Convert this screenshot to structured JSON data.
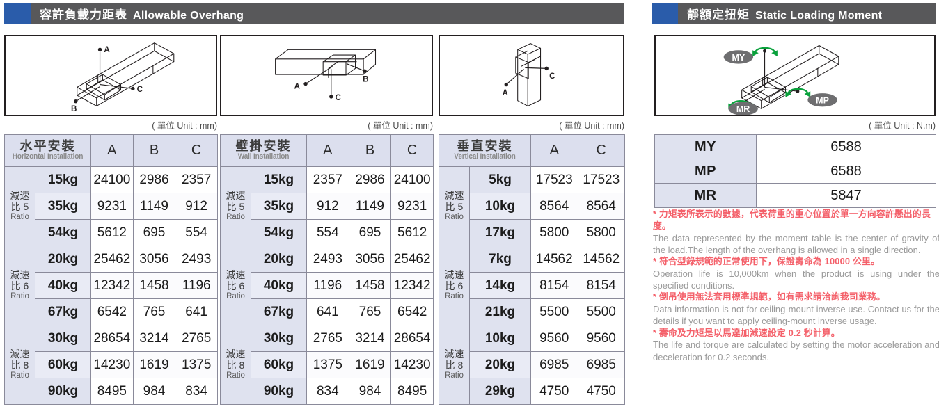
{
  "sections": {
    "overhang": {
      "title_cn": "容許負載力距表",
      "title_en": "Allowable Overhang",
      "accent_color": "#2a5caa",
      "bar_color": "#58585a"
    },
    "moment": {
      "title_cn": "靜額定扭矩",
      "title_en": "Static Loading Moment",
      "accent_color": "#2a5caa",
      "bar_color": "#58585a"
    }
  },
  "unit_labels": {
    "mm": "( 單位 Unit : mm)",
    "nm": "( 單位 Unit : N.m)"
  },
  "diagram_markers": {
    "horizontal": [
      "A",
      "B",
      "C"
    ],
    "wall": [
      "A",
      "B",
      "C"
    ],
    "vertical": [
      "A",
      "C"
    ],
    "moment": [
      "MY",
      "MP",
      "MR"
    ]
  },
  "overhang_tables": [
    {
      "id": "horizontal",
      "header_cn": "水平安裝",
      "header_en": "Horizontal Installation",
      "columns": [
        "A",
        "B",
        "C"
      ],
      "groups": [
        {
          "ratio_line1": "減速",
          "ratio_line2": "比 5",
          "ratio_line3": "Ratio",
          "rows": [
            {
              "load": "15kg",
              "values": [
                "24100",
                "2986",
                "2357"
              ]
            },
            {
              "load": "35kg",
              "values": [
                "9231",
                "1149",
                "912"
              ]
            },
            {
              "load": "54kg",
              "values": [
                "5612",
                "695",
                "554"
              ]
            }
          ]
        },
        {
          "ratio_line1": "減速",
          "ratio_line2": "比 6",
          "ratio_line3": "Ratio",
          "rows": [
            {
              "load": "20kg",
              "values": [
                "25462",
                "3056",
                "2493"
              ]
            },
            {
              "load": "40kg",
              "values": [
                "12342",
                "1458",
                "1196"
              ]
            },
            {
              "load": "67kg",
              "values": [
                "6542",
                "765",
                "641"
              ]
            }
          ]
        },
        {
          "ratio_line1": "減速",
          "ratio_line2": "比 8",
          "ratio_line3": "Ratio",
          "rows": [
            {
              "load": "30kg",
              "values": [
                "28654",
                "3214",
                "2765"
              ]
            },
            {
              "load": "60kg",
              "values": [
                "14230",
                "1619",
                "1375"
              ]
            },
            {
              "load": "90kg",
              "values": [
                "8495",
                "984",
                "834"
              ]
            }
          ]
        }
      ]
    },
    {
      "id": "wall",
      "header_cn": "壁掛安裝",
      "header_en": "Wall Installation",
      "columns": [
        "A",
        "B",
        "C"
      ],
      "groups": [
        {
          "ratio_line1": "減速",
          "ratio_line2": "比 5",
          "ratio_line3": "Ratio",
          "rows": [
            {
              "load": "15kg",
              "values": [
                "2357",
                "2986",
                "24100"
              ]
            },
            {
              "load": "35kg",
              "values": [
                "912",
                "1149",
                "9231"
              ]
            },
            {
              "load": "54kg",
              "values": [
                "554",
                "695",
                "5612"
              ]
            }
          ]
        },
        {
          "ratio_line1": "減速",
          "ratio_line2": "比 6",
          "ratio_line3": "Ratio",
          "rows": [
            {
              "load": "20kg",
              "values": [
                "2493",
                "3056",
                "25462"
              ]
            },
            {
              "load": "40kg",
              "values": [
                "1196",
                "1458",
                "12342"
              ]
            },
            {
              "load": "67kg",
              "values": [
                "641",
                "765",
                "6542"
              ]
            }
          ]
        },
        {
          "ratio_line1": "減速",
          "ratio_line2": "比 8",
          "ratio_line3": "Ratio",
          "rows": [
            {
              "load": "30kg",
              "values": [
                "2765",
                "3214",
                "28654"
              ]
            },
            {
              "load": "60kg",
              "values": [
                "1375",
                "1619",
                "14230"
              ]
            },
            {
              "load": "90kg",
              "values": [
                "834",
                "984",
                "8495"
              ]
            }
          ]
        }
      ]
    },
    {
      "id": "vertical",
      "header_cn": "垂直安裝",
      "header_en": "Vertical Installation",
      "columns": [
        "A",
        "C"
      ],
      "groups": [
        {
          "ratio_line1": "減速",
          "ratio_line2": "比 5",
          "ratio_line3": "Ratio",
          "rows": [
            {
              "load": "5kg",
              "values": [
                "17523",
                "17523"
              ]
            },
            {
              "load": "10kg",
              "values": [
                "8564",
                "8564"
              ]
            },
            {
              "load": "17kg",
              "values": [
                "5800",
                "5800"
              ]
            }
          ]
        },
        {
          "ratio_line1": "減速",
          "ratio_line2": "比 6",
          "ratio_line3": "Ratio",
          "rows": [
            {
              "load": "7kg",
              "values": [
                "14562",
                "14562"
              ]
            },
            {
              "load": "14kg",
              "values": [
                "8154",
                "8154"
              ]
            },
            {
              "load": "21kg",
              "values": [
                "5500",
                "5500"
              ]
            }
          ]
        },
        {
          "ratio_line1": "減速",
          "ratio_line2": "比 8",
          "ratio_line3": "Ratio",
          "rows": [
            {
              "load": "10kg",
              "values": [
                "9560",
                "9560"
              ]
            },
            {
              "load": "20kg",
              "values": [
                "6985",
                "6985"
              ]
            },
            {
              "load": "29kg",
              "values": [
                "4750",
                "4750"
              ]
            }
          ]
        }
      ]
    }
  ],
  "moment_table": {
    "rows": [
      {
        "label": "MY",
        "value": "6588"
      },
      {
        "label": "MP",
        "value": "6588"
      },
      {
        "label": "MR",
        "value": "5847"
      }
    ]
  },
  "notes": [
    {
      "cn": "* 力矩表所表示的數據，代表荷重的重心位置於單一方向容許懸出的長度。",
      "en": "The data represented by the moment table is the center of gravity of the load.The length of the overhang is allowed in a single direction."
    },
    {
      "cn": "* 符合型錄規範的正常使用下，保證壽命為 10000 公里。",
      "en": "Operation life is 10,000km when the product is using under the specified conditions."
    },
    {
      "cn": "* 倒吊使用無法套用標準規範，如有需求請洽詢我司業務。",
      "en": "Data information is not for ceiling-mount inverse use. Contact us for the details if you want to apply ceiling-mount inverse usage."
    },
    {
      "cn": "* 壽命及力矩是以馬達加減速設定 0.2 秒計算。",
      "en": "The life and torque are calculated by setting the motor acceleration and deceleration for 0.2 seconds."
    }
  ]
}
